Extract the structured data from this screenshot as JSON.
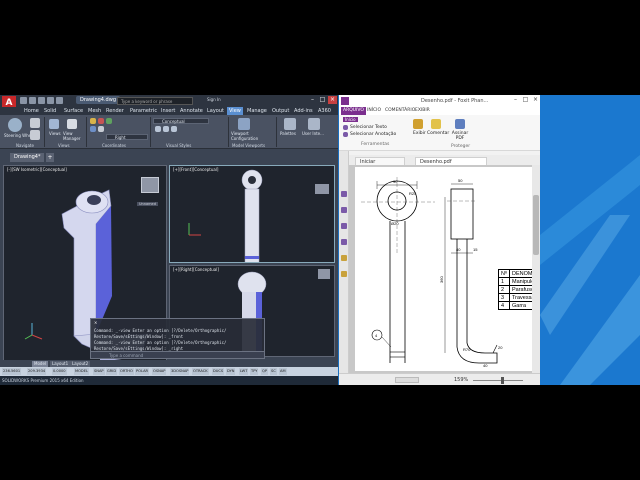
{
  "acad": {
    "document_title": "Drawing4.dwg",
    "search_placeholder": "Type a keyword or phrase",
    "signin": "Sign In",
    "menu": [
      "Home",
      "Solid",
      "Surface",
      "Mesh",
      "Render",
      "Parametric",
      "Insert",
      "Annotate",
      "Layout",
      "View",
      "Manage",
      "Output",
      "Add-ins",
      "A360"
    ],
    "active_menu": "View",
    "ribbon": {
      "steering_wheels": "Steering Wheels",
      "views": "Views",
      "view_manager": "View Manager",
      "visual_style": "Conceptual",
      "view_dd": "Right",
      "viewport_config": "Viewport Configuration",
      "palettes": "Palettes",
      "user_interface": "User Inte...",
      "groups": [
        "Navigate",
        "Views",
        "Coordinates",
        "Visual Styles",
        "Model Viewports"
      ]
    },
    "doc_tab": "Drawing4*",
    "viewports": {
      "iso": "[-][SW Isometric][Conceptual]",
      "front": "[+][Front][Conceptual]",
      "right": "[+][Right][Conceptual]"
    },
    "viewcube_label": "Unnamed",
    "command_lines": [
      "Command: _-view Enter an option [?/Delete/Orthographic/",
      "Restore/Save/sEttings/Window]: _front",
      "Command: _-view Enter an option [?/Delete/Orthographic/",
      "Restore/Save/sEttings/Window]: _right"
    ],
    "command_placeholder": "Type a command",
    "layout_tabs": [
      "Model",
      "Layout1",
      "Layout2"
    ],
    "status_items": [
      "236.5601",
      "209.3934",
      "0.0000",
      "MODEL",
      "SNAP",
      "GRID",
      "ORTHO",
      "POLAR",
      "OSNAP",
      "3DOSNAP",
      "OTRACK",
      "DUCS",
      "DYN",
      "LWT",
      "TPY",
      "QP",
      "SC",
      "AM"
    ],
    "bottom_text": "SOLIDWORKS Premium 2015 x64 Edition"
  },
  "foxit": {
    "title": "Desenho.pdf - Foxit Phan...",
    "menu": [
      "ARQUIVO",
      "INÍCIO",
      "COMENTÁRIO",
      "EXIBIR",
      "FORMULÁRIO"
    ],
    "active_menu": "ARQUIVO",
    "search_placeholder": "Procurar",
    "ribbon": {
      "active_tab_small": "Início",
      "select_text": "Selecionar Texto",
      "select_annotation": "Selecionar Anotação",
      "tools_group": "Ferramentas",
      "view": "Exibir",
      "comment": "Comentar",
      "sign": "Assinar PDF",
      "protect_group": "Proteger"
    },
    "tabs": [
      "Iniciar",
      "Desenho.pdf"
    ],
    "zoom": "159%",
    "drawing": {
      "dim_90": "90",
      "dim_50": "50",
      "dim_r25": "R25",
      "dim_d20": "Ø20",
      "dim_40": "40",
      "dim_15": "15",
      "dim_360": "360",
      "dim_15b": "15",
      "dim_r70": "R70",
      "dim_20": "20",
      "dim_r15": "R15",
      "dim_40b": "40",
      "balloon": "4"
    },
    "parts_table": {
      "headers": [
        "Nº",
        "DENOMIN"
      ],
      "rows": [
        [
          "1",
          "Manipulo"
        ],
        [
          "2",
          "Parafuso"
        ],
        [
          "3",
          "Travessa"
        ],
        [
          "4",
          "Garra"
        ]
      ]
    }
  },
  "colors": {
    "acad_bg": "#3b4453",
    "viewport_bg": "#1f242d",
    "model_fill": "#cfd3e8",
    "model_accent": "#5a62d8",
    "foxit_accent": "#7b2f8e",
    "desktop": "#1d7ed3"
  }
}
